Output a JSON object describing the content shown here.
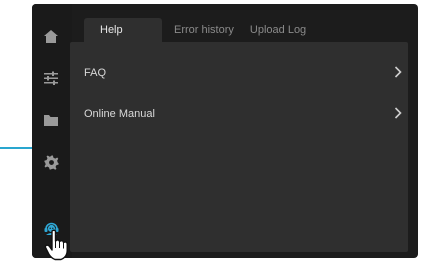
{
  "sidebar": {
    "items": [
      {
        "icon": "home-icon",
        "active": false
      },
      {
        "icon": "sliders-icon",
        "active": false
      },
      {
        "icon": "folder-icon",
        "active": false
      },
      {
        "icon": "gear-icon",
        "active": false
      },
      {
        "icon": "support-agent-icon",
        "active": true
      }
    ]
  },
  "tabs": [
    {
      "label": "Help",
      "active": true
    },
    {
      "label": "Error history",
      "active": false
    },
    {
      "label": "Upload Log",
      "active": false
    }
  ],
  "menu": {
    "items": [
      {
        "label": "FAQ",
        "icon": "chevron-right-icon"
      },
      {
        "label": "Online Manual",
        "icon": "chevron-right-icon"
      }
    ]
  },
  "colors": {
    "accent": "#29a6cf",
    "active_icon": "#2fa8d6",
    "icon_default": "#9a9a9a",
    "panel": "#2f2f2f",
    "background": "#1c1c1c"
  },
  "cursor": {
    "icon": "hand-pointer-icon"
  }
}
